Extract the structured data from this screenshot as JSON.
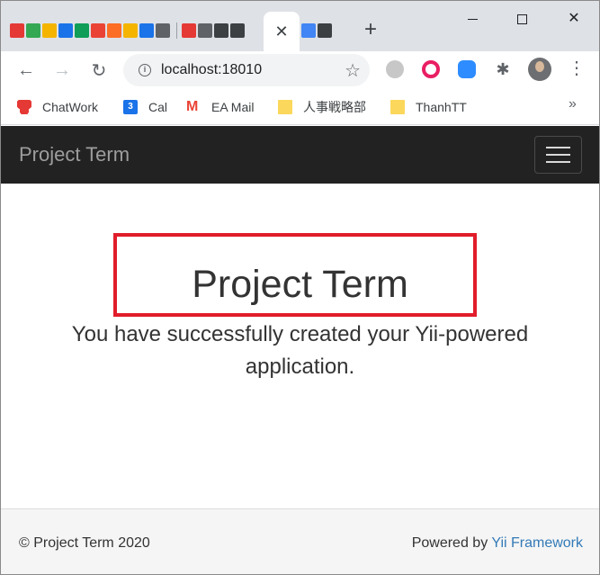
{
  "browser": {
    "tabs": {
      "icons": [
        {
          "name": "chatwork-tab-icon",
          "color": "#e53935"
        },
        {
          "name": "google-drive-tab-icon",
          "color": "#34a853"
        },
        {
          "name": "google-slides-tab-icon",
          "color": "#f4b400"
        },
        {
          "name": "google-drive-tab-icon",
          "color": "#1a73e8"
        },
        {
          "name": "google-sheets-tab-icon",
          "color": "#0f9d58"
        },
        {
          "name": "gmail-tab-icon",
          "color": "#ea4335"
        },
        {
          "name": "gitlab-tab-icon",
          "color": "#fc6d26"
        },
        {
          "name": "google-slides-tab-icon",
          "color": "#f4b400"
        },
        {
          "name": "google-calendar-tab-icon",
          "color": "#1a73e8"
        },
        {
          "name": "loading-tab-icon",
          "color": "#5f6368"
        },
        {
          "name": "loading-tab-icon",
          "color": "#e53935"
        },
        {
          "name": "loading-tab-icon",
          "color": "#5f6368"
        },
        {
          "name": "robot-tab-icon",
          "color": "#3c4043"
        },
        {
          "name": "robot-tab-icon",
          "color": "#3c4043"
        }
      ],
      "after_active_icons": [
        {
          "name": "google-tab-icon",
          "color": "#4285f4"
        },
        {
          "name": "robot-tab-icon",
          "color": "#3c4043"
        }
      ],
      "active_close": "✕",
      "new_tab": "+"
    },
    "window_controls": {
      "minimize": "—",
      "maximize": "☐",
      "close": "✕"
    },
    "toolbar": {
      "back": "←",
      "forward": "→",
      "reload": "↻",
      "info": "i",
      "url": "localhost:18010",
      "bookmark_star": "☆",
      "extensions_icon": "✱",
      "menu": "⋮"
    },
    "bookmarks": [
      {
        "label": "ChatWork"
      },
      {
        "label": "Cal",
        "icon_text": "3"
      },
      {
        "label": "EA Mail",
        "icon_text": "M"
      },
      {
        "label": "人事戦略部"
      },
      {
        "label": "ThanhTT"
      }
    ],
    "bookmarks_more": "»"
  },
  "page": {
    "brand": "Project Term",
    "title": "Project Term",
    "lead": "You have successfully created your Yii-powered application.",
    "footer": {
      "copyright": "© Project Term 2020",
      "powered_by": "Powered by ",
      "framework_link": "Yii Framework"
    }
  },
  "colors": {
    "navbar": "#222222",
    "highlight_border": "#e11d2a",
    "link": "#337ab7"
  }
}
